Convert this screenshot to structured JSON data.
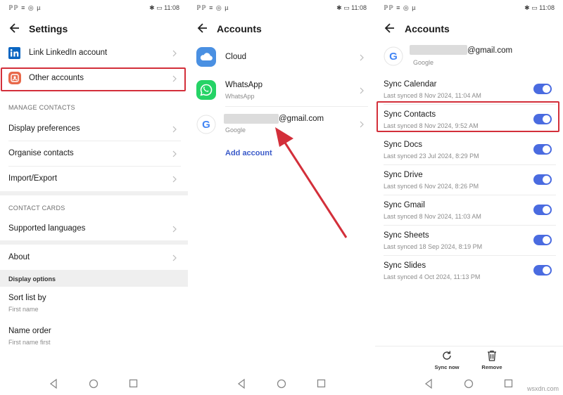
{
  "status": {
    "left": "ℙℙ ≡ ◎ µ",
    "right": "✱ ▭ 11:08"
  },
  "panel1": {
    "title": "Settings",
    "items": {
      "linkedin": "Link LinkedIn account",
      "other_accounts": "Other accounts",
      "manage_contacts_section": "MANAGE CONTACTS",
      "display_prefs": "Display preferences",
      "organise": "Organise contacts",
      "import_export": "Import/Export",
      "contact_cards_section": "CONTACT CARDS",
      "languages": "Supported languages",
      "about": "About",
      "display_options_section": "Display options",
      "sort_list": "Sort list by",
      "sort_list_value": "First name",
      "name_order": "Name order",
      "name_order_value": "First name first"
    }
  },
  "panel2": {
    "title": "Accounts",
    "accounts": [
      {
        "name": "Cloud",
        "type": ""
      },
      {
        "name": "WhatsApp",
        "type": "WhatsApp"
      },
      {
        "name": "@gmail.com",
        "type": "Google"
      }
    ],
    "add_account": "Add account"
  },
  "panel3": {
    "title": "Accounts",
    "account_email": "@gmail.com",
    "account_type": "Google",
    "sync_items": [
      {
        "name": "Sync Calendar",
        "last": "Last synced 8 Nov 2024, 11:04 AM",
        "on": true
      },
      {
        "name": "Sync Contacts",
        "last": "Last synced 8 Nov 2024, 9:52 AM",
        "on": true
      },
      {
        "name": "Sync Docs",
        "last": "Last synced 23 Jul 2024, 8:29 PM",
        "on": true
      },
      {
        "name": "Sync Drive",
        "last": "Last synced 6 Nov 2024, 8:26 PM",
        "on": true
      },
      {
        "name": "Sync Gmail",
        "last": "Last synced 8 Nov 2024, 11:03 AM",
        "on": true
      },
      {
        "name": "Sync Sheets",
        "last": "Last synced 18 Sep 2024, 8:19 PM",
        "on": true
      },
      {
        "name": "Sync Slides",
        "last": "Last synced 4 Oct 2024, 11:13 PM",
        "on": true
      }
    ],
    "sync_now": "Sync now",
    "remove": "Remove"
  },
  "watermark": "wsxdn.com",
  "colors": {
    "accent": "#4a6be0",
    "highlight": "#d32f3a",
    "linkedin": "#0a66c2",
    "whatsapp": "#25d366",
    "cloud": "#4a90e2"
  }
}
